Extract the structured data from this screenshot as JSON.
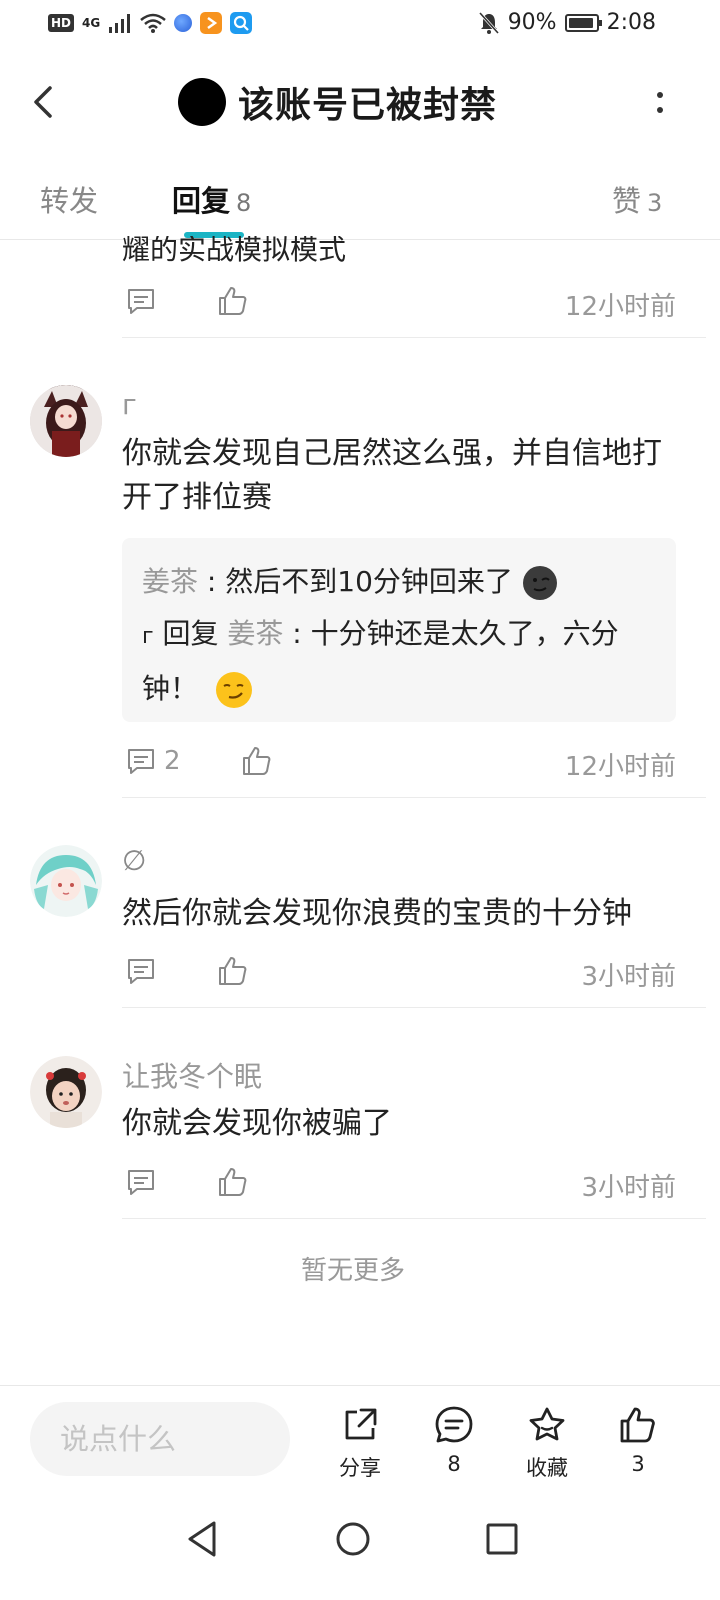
{
  "status_bar": {
    "left_icons": [
      "hd-icon",
      "4g-icon",
      "signal-icon",
      "wifi-icon",
      "app-icon-blue",
      "app-icon-orange",
      "app-icon-search"
    ],
    "network": "4G",
    "battery_percent": "90%",
    "time": "2:08"
  },
  "header": {
    "title": "该账号已被封禁"
  },
  "tabs": [
    {
      "label": "转发",
      "count": ""
    },
    {
      "label": "回复",
      "count": "8"
    },
    {
      "label": "赞",
      "count": "3"
    }
  ],
  "partial_comment": {
    "text": "耀的实战模拟模式",
    "time": "12小时前"
  },
  "comments": [
    {
      "username": "г",
      "text": "你就会发现自己居然这么强，并自信地打开了排位赛",
      "replies": [
        {
          "name": "姜茶",
          "sep": " : ",
          "text": "然后不到10分钟回来了"
        },
        {
          "prefix": "г",
          "reply_word": "回复",
          "name": "姜茶",
          "sep": " : ",
          "text": "十分钟还是太久了，六分钟！"
        }
      ],
      "reply_count": "2",
      "time": "12小时前"
    },
    {
      "username": "∅",
      "text": "然后你就会发现你浪费的宝贵的十分钟",
      "time": "3小时前"
    },
    {
      "username": "让我冬个眠",
      "text": "你就会发现你被骗了",
      "time": "3小时前"
    }
  ],
  "no_more": "暂无更多",
  "bottom_bar": {
    "input_placeholder": "说点什么",
    "share_label": "分享",
    "comment_count": "8",
    "favorite_label": "收藏",
    "like_count": "3"
  },
  "colors": {
    "accent": "#1bb4c4",
    "text_primary": "#222222",
    "text_secondary": "#999999"
  }
}
